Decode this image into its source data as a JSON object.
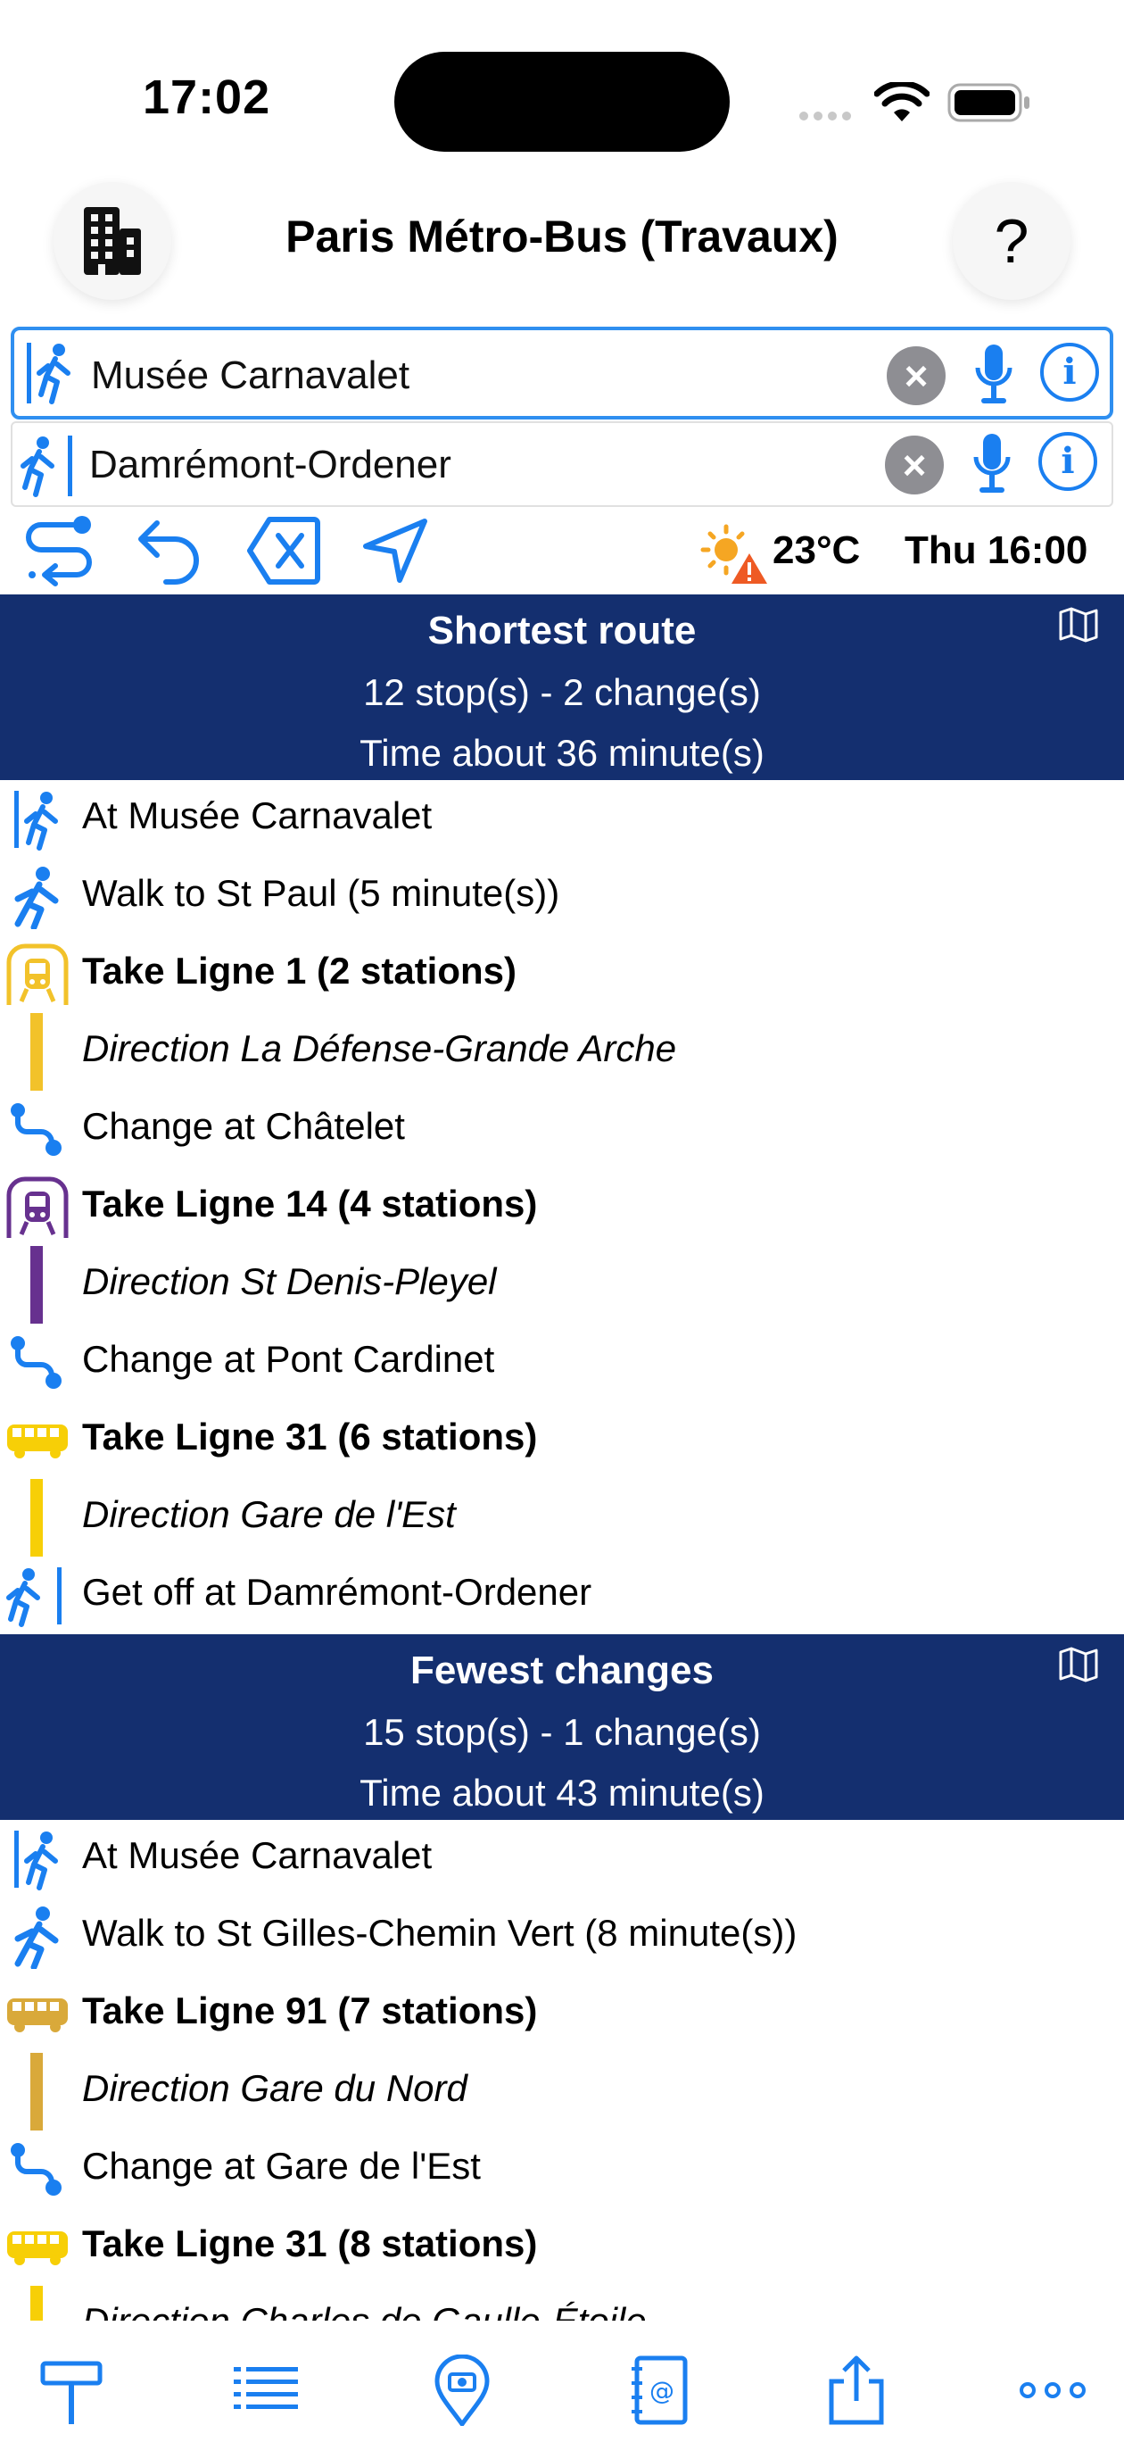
{
  "status_bar": {
    "time": "17:02"
  },
  "header": {
    "title": "Paris Métro-Bus (Travaux)",
    "help_label": "?"
  },
  "search": {
    "origin": "Musée Carnavalet",
    "destination": "Damrémont-Ordener"
  },
  "toolbar": {
    "icons": [
      "route-icon",
      "undo-icon",
      "clear-delete-icon",
      "locate-arrow-icon"
    ],
    "weather_temp": "23°C",
    "weather_when": "Thu 16:00"
  },
  "colors": {
    "accent": "#1a7ff0",
    "header_bg": "#142f6f",
    "ligne1": "#f2c22a",
    "ligne14": "#67318f",
    "bus31": "#f7cf07",
    "bus91": "#d9a93a"
  },
  "routes": [
    {
      "title": "Shortest route",
      "stops": "12 stop(s) - 2 change(s)",
      "time": "Time about 36 minute(s)",
      "steps": [
        {
          "icon": "walk-start-icon",
          "text": "At Musée Carnavalet",
          "style": "normal"
        },
        {
          "icon": "walk-icon",
          "text": "Walk to St Paul (5 minute(s))",
          "style": "normal"
        },
        {
          "icon": "metro-icon",
          "text": "Take Ligne 1 (2 stations)",
          "style": "bold",
          "color": "#f2c22a"
        },
        {
          "icon": "line-bar",
          "text": "Direction La Défense-Grande Arche",
          "style": "italic",
          "color": "#f2c22a"
        },
        {
          "icon": "change-icon",
          "text": "Change at Châtelet",
          "style": "normal"
        },
        {
          "icon": "metro-icon",
          "text": "Take Ligne 14 (4 stations)",
          "style": "bold",
          "color": "#67318f"
        },
        {
          "icon": "line-bar",
          "text": "Direction St Denis-Pleyel",
          "style": "italic",
          "color": "#67318f"
        },
        {
          "icon": "change-icon",
          "text": "Change at Pont Cardinet",
          "style": "normal"
        },
        {
          "icon": "bus-icon",
          "text": "Take Ligne 31 (6 stations)",
          "style": "bold",
          "color": "#f7cf07"
        },
        {
          "icon": "line-bar",
          "text": "Direction Gare de l'Est",
          "style": "italic",
          "color": "#f7cf07"
        },
        {
          "icon": "walk-end-icon",
          "text": "Get off at Damrémont-Ordener",
          "style": "normal"
        }
      ]
    },
    {
      "title": "Fewest changes",
      "stops": "15 stop(s) - 1 change(s)",
      "time": "Time about 43 minute(s)",
      "steps": [
        {
          "icon": "walk-start-icon",
          "text": "At Musée Carnavalet",
          "style": "normal"
        },
        {
          "icon": "walk-icon",
          "text": "Walk to St Gilles-Chemin Vert (8 minute(s))",
          "style": "normal"
        },
        {
          "icon": "bus-icon",
          "text": "Take Ligne 91 (7 stations)",
          "style": "bold",
          "color": "#d9a93a"
        },
        {
          "icon": "line-bar",
          "text": "Direction Gare du Nord",
          "style": "italic",
          "color": "#d9a93a"
        },
        {
          "icon": "change-icon",
          "text": "Change at Gare de l'Est",
          "style": "normal"
        },
        {
          "icon": "bus-icon",
          "text": "Take Ligne 31 (8 stations)",
          "style": "bold",
          "color": "#f7cf07"
        },
        {
          "icon": "line-bar",
          "text": "Direction Charles de Gaulle-Étoile",
          "style": "italic",
          "color": "#f7cf07"
        }
      ]
    }
  ],
  "tabbar": [
    "stop-sign-icon",
    "list-icon",
    "location-camera-icon",
    "address-book-icon",
    "share-icon",
    "more-icon"
  ]
}
